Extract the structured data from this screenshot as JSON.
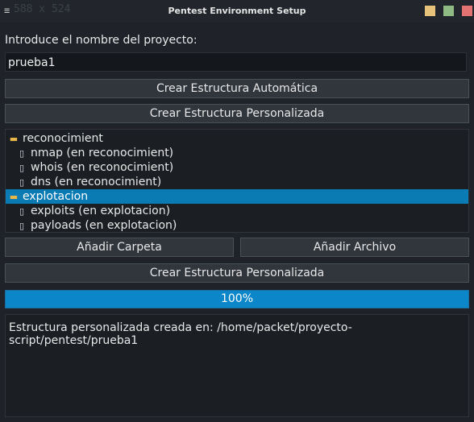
{
  "window": {
    "title": "Pentest Environment Setup",
    "size_text": "588 x 524",
    "menu_icon": "hamburger-icon",
    "controls": [
      {
        "name": "minimize",
        "color": "#e6c27a"
      },
      {
        "name": "maximize",
        "color": "#8fba84"
      },
      {
        "name": "close",
        "color": "#e37272"
      }
    ]
  },
  "form": {
    "project_label": "Introduce el nombre del proyecto:",
    "project_value": "prueba1",
    "auto_button": "Crear Estructura Automática",
    "custom_button_top": "Crear Estructura Personalizada"
  },
  "tree": {
    "items": [
      {
        "label": "reconocimient",
        "type": "folder",
        "selected": false
      },
      {
        "label": "nmap (en reconocimient)",
        "type": "file",
        "selected": false
      },
      {
        "label": "whois (en reconocimient)",
        "type": "file",
        "selected": false
      },
      {
        "label": "dns (en reconocimient)",
        "type": "file",
        "selected": false
      },
      {
        "label": "explotacion",
        "type": "folder",
        "selected": true
      },
      {
        "label": "exploits (en explotacion)",
        "type": "file",
        "selected": false
      },
      {
        "label": "payloads (en explotacion)",
        "type": "file",
        "selected": false
      }
    ]
  },
  "actions": {
    "add_folder": "Añadir Carpeta",
    "add_file": "Añadir Archivo",
    "create_custom": "Crear Estructura Personalizada"
  },
  "progress": {
    "value": 100,
    "label": "100%",
    "color": "#0a86c9"
  },
  "output": {
    "text": "Estructura personalizada creada en: /home/packet/proyecto-script/pentest/prueba1"
  },
  "colors": {
    "accent": "#0b7bb3",
    "background": "#1f2329"
  }
}
